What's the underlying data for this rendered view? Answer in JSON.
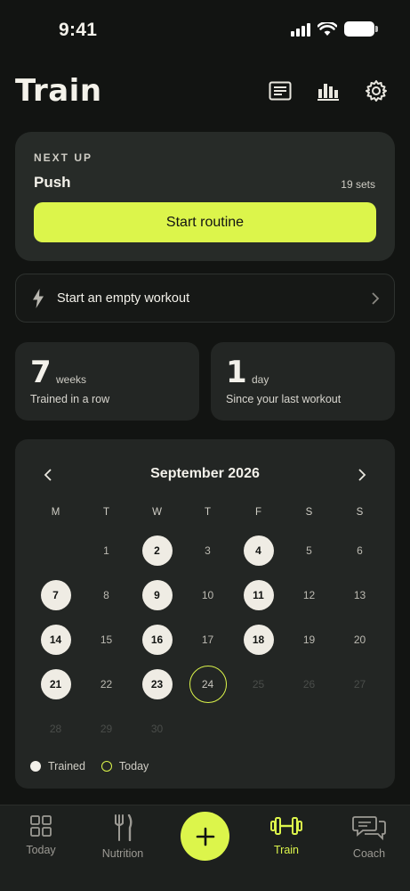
{
  "status_bar": {
    "time": "9:41"
  },
  "header": {
    "title": "Train",
    "icons": [
      "log-icon",
      "stats-icon",
      "gear-icon"
    ]
  },
  "next_up": {
    "label": "NEXT UP",
    "routine": "Push",
    "sets": "19 sets",
    "button": "Start routine"
  },
  "empty_workout": {
    "label": "Start an empty workout"
  },
  "stats": [
    {
      "value": "7",
      "unit": "weeks",
      "desc": "Trained in a row"
    },
    {
      "value": "1",
      "unit": "day",
      "desc": "Since your last workout"
    }
  ],
  "calendar": {
    "title": "September 2026",
    "weekdays": [
      "M",
      "T",
      "W",
      "T",
      "F",
      "S",
      "S"
    ],
    "weeks": [
      [
        null,
        {
          "d": "1",
          "s": "plain"
        },
        {
          "d": "2",
          "s": "trained"
        },
        {
          "d": "3",
          "s": "plain"
        },
        {
          "d": "4",
          "s": "trained"
        },
        {
          "d": "5",
          "s": "plain"
        },
        {
          "d": "6",
          "s": "plain"
        }
      ],
      [
        {
          "d": "7",
          "s": "trained"
        },
        {
          "d": "8",
          "s": "plain"
        },
        {
          "d": "9",
          "s": "trained"
        },
        {
          "d": "10",
          "s": "plain"
        },
        {
          "d": "11",
          "s": "trained"
        },
        {
          "d": "12",
          "s": "plain"
        },
        {
          "d": "13",
          "s": "plain"
        }
      ],
      [
        {
          "d": "14",
          "s": "trained"
        },
        {
          "d": "15",
          "s": "plain"
        },
        {
          "d": "16",
          "s": "trained"
        },
        {
          "d": "17",
          "s": "plain"
        },
        {
          "d": "18",
          "s": "trained"
        },
        {
          "d": "19",
          "s": "plain"
        },
        {
          "d": "20",
          "s": "plain"
        }
      ],
      [
        {
          "d": "21",
          "s": "trained"
        },
        {
          "d": "22",
          "s": "plain"
        },
        {
          "d": "23",
          "s": "trained"
        },
        {
          "d": "24",
          "s": "today"
        },
        {
          "d": "25",
          "s": "future"
        },
        {
          "d": "26",
          "s": "future"
        },
        {
          "d": "27",
          "s": "future"
        }
      ],
      [
        {
          "d": "28",
          "s": "future"
        },
        {
          "d": "29",
          "s": "future"
        },
        {
          "d": "30",
          "s": "future"
        },
        null,
        null,
        null,
        null
      ]
    ],
    "legend": {
      "trained": "Trained",
      "today": "Today"
    }
  },
  "tabs": [
    {
      "label": "Today",
      "icon": "grid-icon"
    },
    {
      "label": "Nutrition",
      "icon": "fork-knife-icon"
    },
    {
      "label": "Train",
      "icon": "dumbbell-icon",
      "active": true
    },
    {
      "label": "Coach",
      "icon": "chat-icon"
    }
  ],
  "colors": {
    "accent": "#dcf54b",
    "background": "#121412",
    "card": "#232624"
  }
}
